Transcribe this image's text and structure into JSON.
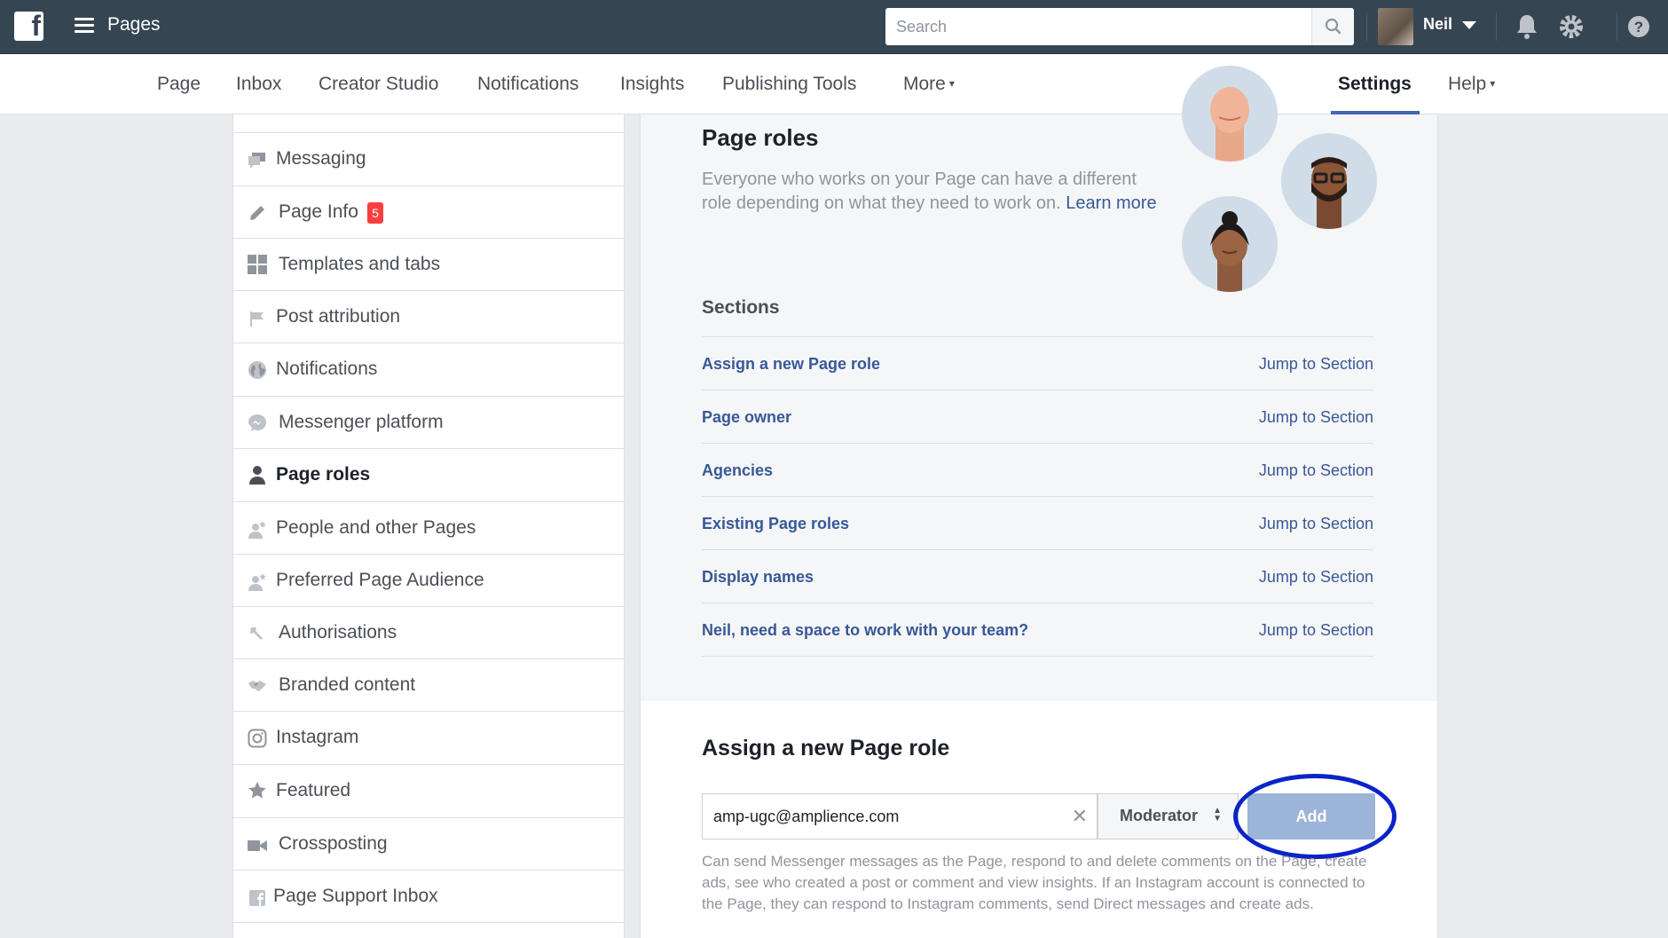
{
  "topbar": {
    "app_title": "Pages",
    "search_placeholder": "Search",
    "user_name": "Neil"
  },
  "nav": {
    "items": [
      "Page",
      "Inbox",
      "Creator Studio",
      "Notifications",
      "Insights",
      "Publishing Tools",
      "More",
      "Settings",
      "Help"
    ],
    "more_caret": "▾",
    "help_caret": "▾",
    "active": "Settings"
  },
  "sidebar": {
    "items": [
      {
        "label": "Messaging",
        "icon": "speech-bubbles-icon"
      },
      {
        "label": "Page Info",
        "icon": "pencil-icon",
        "badge": "5"
      },
      {
        "label": "Templates and tabs",
        "icon": "grid-icon"
      },
      {
        "label": "Post attribution",
        "icon": "flag-icon"
      },
      {
        "label": "Notifications",
        "icon": "globe-icon"
      },
      {
        "label": "Messenger platform",
        "icon": "messenger-icon"
      },
      {
        "label": "Page roles",
        "icon": "person-icon",
        "active": true
      },
      {
        "label": "People and other Pages",
        "icon": "person-star-icon"
      },
      {
        "label": "Preferred Page Audience",
        "icon": "person-star-icon"
      },
      {
        "label": "Authorisations",
        "icon": "wrench-icon"
      },
      {
        "label": "Branded content",
        "icon": "handshake-icon"
      },
      {
        "label": "Instagram",
        "icon": "instagram-icon"
      },
      {
        "label": "Featured",
        "icon": "star-icon"
      },
      {
        "label": "Crossposting",
        "icon": "video-camera-icon"
      },
      {
        "label": "Page Support Inbox",
        "icon": "facebook-square-icon"
      }
    ]
  },
  "main": {
    "title": "Page roles",
    "description": "Everyone who works on your Page can have a different role depending on what they need to work on.",
    "learn_more": "Learn more",
    "sections_title": "Sections",
    "sections": [
      {
        "label": "Assign a new Page role",
        "jump": "Jump to Section"
      },
      {
        "label": "Page owner",
        "jump": "Jump to Section"
      },
      {
        "label": "Agencies",
        "jump": "Jump to Section"
      },
      {
        "label": "Existing Page roles",
        "jump": "Jump to Section"
      },
      {
        "label": "Display names",
        "jump": "Jump to Section"
      },
      {
        "label": "Neil, need a space to work with your team?",
        "jump": "Jump to Section"
      }
    ],
    "assign": {
      "title": "Assign a new Page role",
      "email_value": "amp-ugc@amplience.com",
      "clear_symbol": "✕",
      "role_value": "Moderator",
      "add_label": "Add",
      "role_description": "Can send Messenger messages as the Page, respond to and delete comments on the Page, create ads, see who created a post or comment and view insights. If an Instagram account is connected to the Page, they can respond to Instagram comments, send Direct messages and create ads."
    }
  },
  "colors": {
    "topbar": "#364552",
    "link": "#385898",
    "accent": "#4267b2",
    "add_button": "#9cb4d8",
    "highlight_ring": "#0b24c8",
    "badge": "#fa3e3e"
  }
}
